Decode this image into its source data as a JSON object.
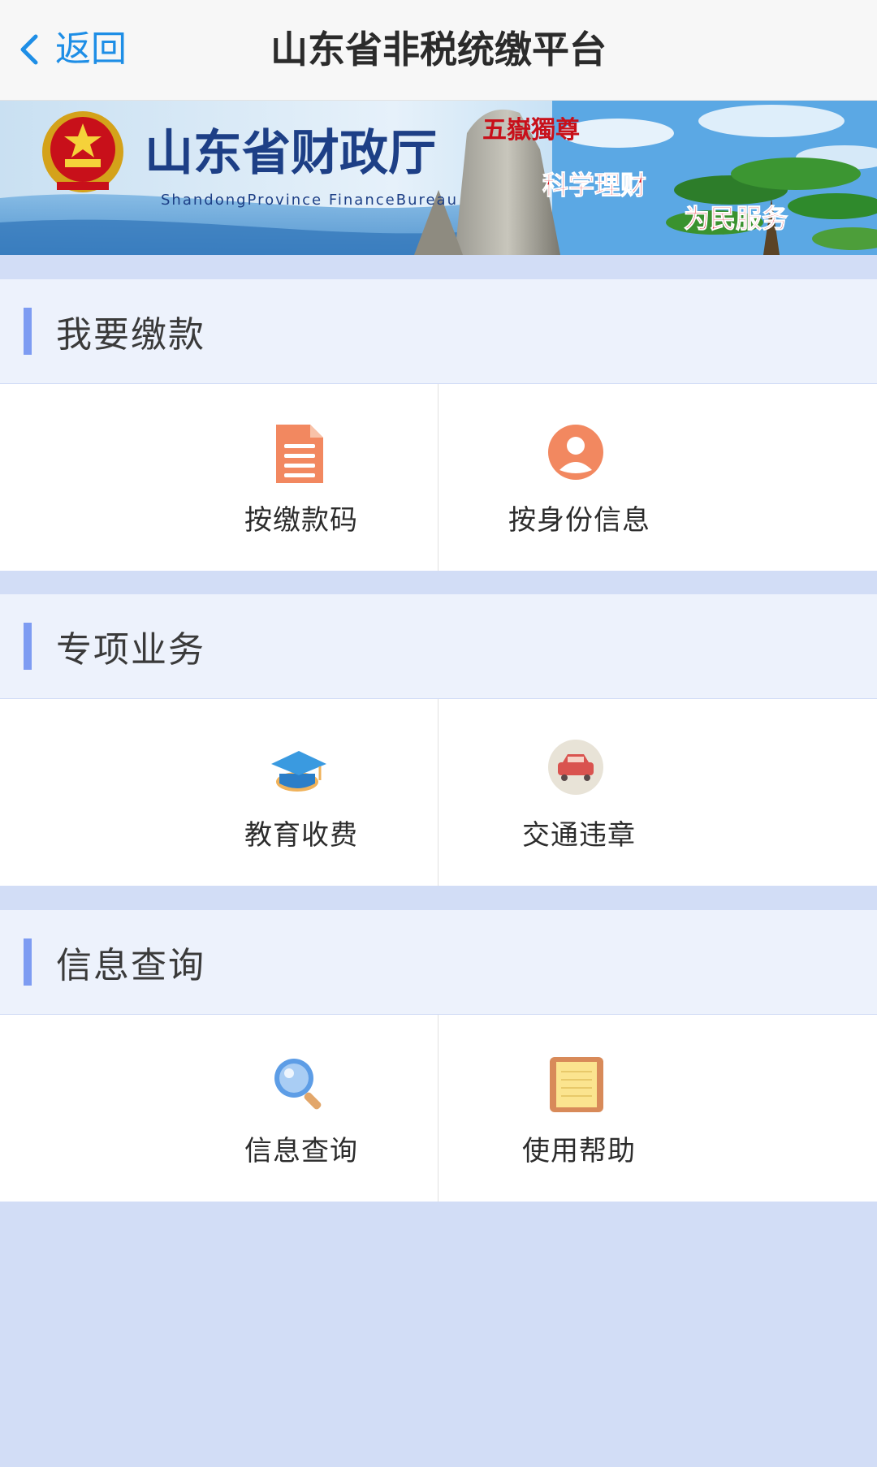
{
  "nav": {
    "back_label": "返回",
    "title": "山东省非税统缴平台"
  },
  "banner": {
    "title": "山东省财政厅",
    "subtitle_en": "ShandongProvince FinanceBureau",
    "rock_inscription": "五嶽獨尊",
    "slogan_1": "科学理财",
    "slogan_2": "为民服务"
  },
  "sections": [
    {
      "title": "我要缴款",
      "items": [
        {
          "label": "按缴款码",
          "icon": "document-icon"
        },
        {
          "label": "按身份信息",
          "icon": "user-icon"
        }
      ]
    },
    {
      "title": "专项业务",
      "items": [
        {
          "label": "教育收费",
          "icon": "graduation-cap-icon"
        },
        {
          "label": "交通违章",
          "icon": "car-icon"
        }
      ]
    },
    {
      "title": "信息查询",
      "items": [
        {
          "label": "信息查询",
          "icon": "magnifier-icon"
        },
        {
          "label": "使用帮助",
          "icon": "notebook-icon"
        }
      ]
    }
  ],
  "colors": {
    "accent": "#1e8ee6",
    "section_bar": "#7e9cf2",
    "page_bg": "#d2ddf6",
    "section_header_bg": "#edf2fc"
  }
}
